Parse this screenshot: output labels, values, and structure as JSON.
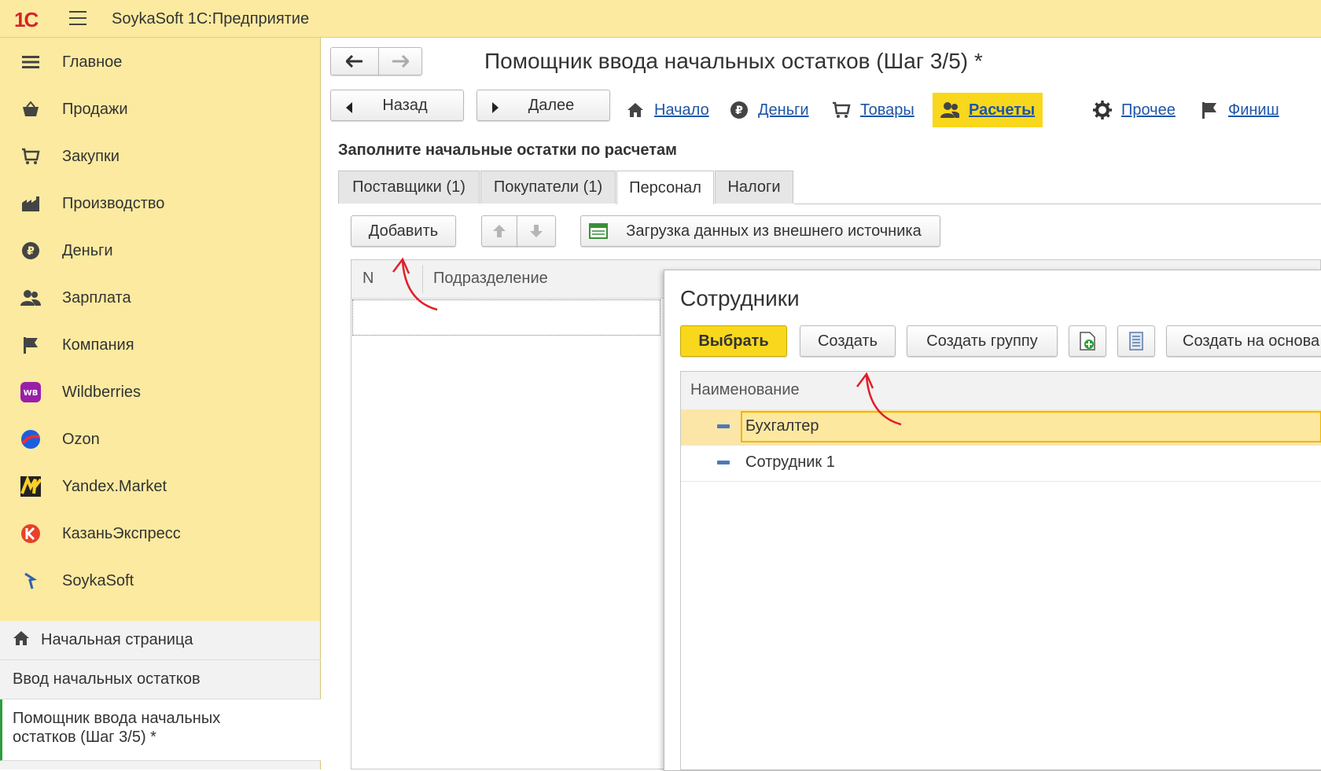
{
  "app": {
    "title": "SoykaSoft 1С:Предприятие",
    "logo": "1С"
  },
  "sidebar": {
    "items": [
      {
        "label": "Главное",
        "icon": "menu-lines-icon"
      },
      {
        "label": "Продажи",
        "icon": "basket-icon"
      },
      {
        "label": "Закупки",
        "icon": "cart-icon"
      },
      {
        "label": "Производство",
        "icon": "factory-icon"
      },
      {
        "label": "Деньги",
        "icon": "ruble-icon"
      },
      {
        "label": "Зарплата",
        "icon": "people-icon"
      },
      {
        "label": "Компания",
        "icon": "flag-icon"
      },
      {
        "label": "Wildberries",
        "icon": "wb-icon"
      },
      {
        "label": "Ozon",
        "icon": "ozon-icon"
      },
      {
        "label": "Yandex.Market",
        "icon": "yandex-market-icon"
      },
      {
        "label": "КазаньЭкспресс",
        "icon": "kazanexpress-icon"
      },
      {
        "label": "SoykaSoft",
        "icon": "soykasoft-icon"
      }
    ],
    "open_windows": [
      {
        "label": "Начальная страница"
      },
      {
        "label": "Ввод начальных остатков"
      },
      {
        "label": "Помощник ввода начальных остатков (Шаг 3/5) *"
      }
    ]
  },
  "main": {
    "title": "Помощник ввода начальных остатков (Шаг 3/5) *",
    "back_label": "Назад",
    "next_label": "Далее",
    "steps": [
      {
        "label": "Начало",
        "icon": "home-icon"
      },
      {
        "label": "Деньги",
        "icon": "ruble-icon"
      },
      {
        "label": "Товары",
        "icon": "cart-icon"
      },
      {
        "label": "Расчеты",
        "icon": "people-icon"
      },
      {
        "label": "Прочее",
        "icon": "gear-icon"
      },
      {
        "label": "Финиш",
        "icon": "flag-icon"
      }
    ],
    "section_label": "Заполните начальные остатки по расчетам",
    "tabs": [
      {
        "label": "Поставщики (1)"
      },
      {
        "label": "Покупатели (1)"
      },
      {
        "label": "Персонал"
      },
      {
        "label": "Налоги"
      }
    ],
    "toolbar": {
      "add_label": "Добавить",
      "import_label": "Загрузка данных из внешнего источника"
    },
    "grid": {
      "columns": [
        "N",
        "Подразделение"
      ]
    }
  },
  "dialog": {
    "title": "Сотрудники",
    "buttons": {
      "select": "Выбрать",
      "create": "Создать",
      "create_group": "Создать группу",
      "create_based": "Создать на основа"
    },
    "column": "Наименование",
    "rows": [
      {
        "name": "Бухгалтер"
      },
      {
        "name": "Сотрудник 1"
      }
    ]
  },
  "colors": {
    "accent": "#f9d71c",
    "sidebar": "#fbeaa0",
    "link": "#1e56a8",
    "annotation": "#e0202a"
  }
}
